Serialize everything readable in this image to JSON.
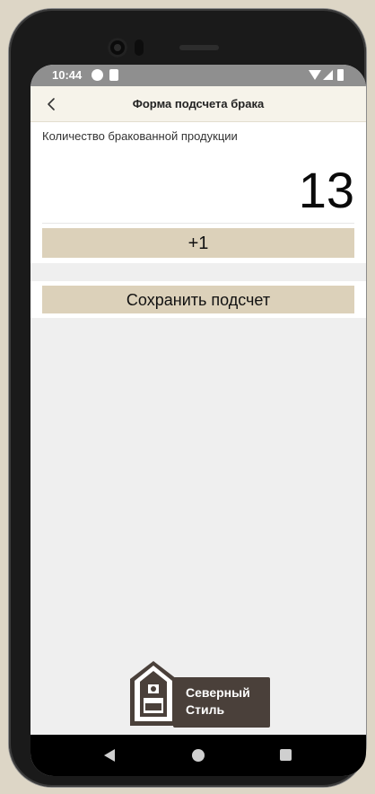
{
  "status_bar": {
    "time": "10:44",
    "icons": [
      "notification-icon",
      "sd-card-icon",
      "wifi-icon",
      "signal-icon",
      "battery-icon"
    ]
  },
  "app_bar": {
    "title": "Форма подсчета брака",
    "back_icon": "chevron-left-icon"
  },
  "counter": {
    "label": "Количество бракованной продукции",
    "value": "13",
    "increment_label": "+1"
  },
  "actions": {
    "save_label": "Сохранить подсчет"
  },
  "brand": {
    "line1": "Северный",
    "line2": "Стиль",
    "badge_color": "#4a403a"
  },
  "colors": {
    "accent": "#dcd1ba",
    "app_bar_bg": "#f6f3ea",
    "content_bg": "#efefef"
  },
  "nav_bar": {
    "icons": [
      "back-nav-icon",
      "home-nav-icon",
      "recents-nav-icon"
    ]
  }
}
